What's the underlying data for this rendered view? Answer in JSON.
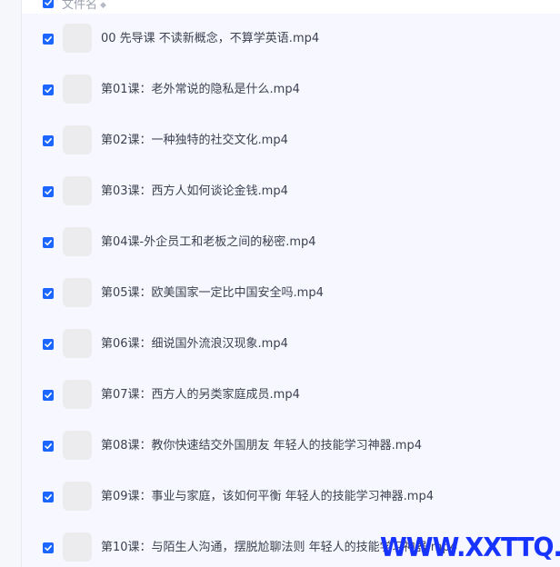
{
  "header": {
    "column_label": "文件名",
    "sort_icon": "sort-icon",
    "all_checked": true
  },
  "accent_color": "#1a66ff",
  "files": [
    {
      "name": "00 先导课 不读新概念，不算学英语.mp4",
      "checked": true
    },
    {
      "name": "第01课：老外常说的隐私是什么.mp4",
      "checked": true
    },
    {
      "name": "第02课：一种独特的社交文化.mp4",
      "checked": true
    },
    {
      "name": "第03课：西方人如何谈论金钱.mp4",
      "checked": true
    },
    {
      "name": "第04课-外企员工和老板之间的秘密.mp4",
      "checked": true
    },
    {
      "name": "第05课：欧美国家一定比中国安全吗.mp4",
      "checked": true
    },
    {
      "name": "第06课：细说国外流浪汉现象.mp4",
      "checked": true
    },
    {
      "name": "第07课：西方人的另类家庭成员.mp4",
      "checked": true
    },
    {
      "name": "第08课：教你快速结交外国朋友 年轻人的技能学习神器.mp4",
      "checked": true
    },
    {
      "name": "第09课：事业与家庭，该如何平衡 年轻人的技能学习神器.mp4",
      "checked": true
    },
    {
      "name": "第10课：与陌生人沟通，摆脱尬聊法则 年轻人的技能学习神器.mp4",
      "checked": true
    }
  ],
  "watermark": {
    "text": "WWW.XXTTQ.COM",
    "color": "#1633ff"
  }
}
